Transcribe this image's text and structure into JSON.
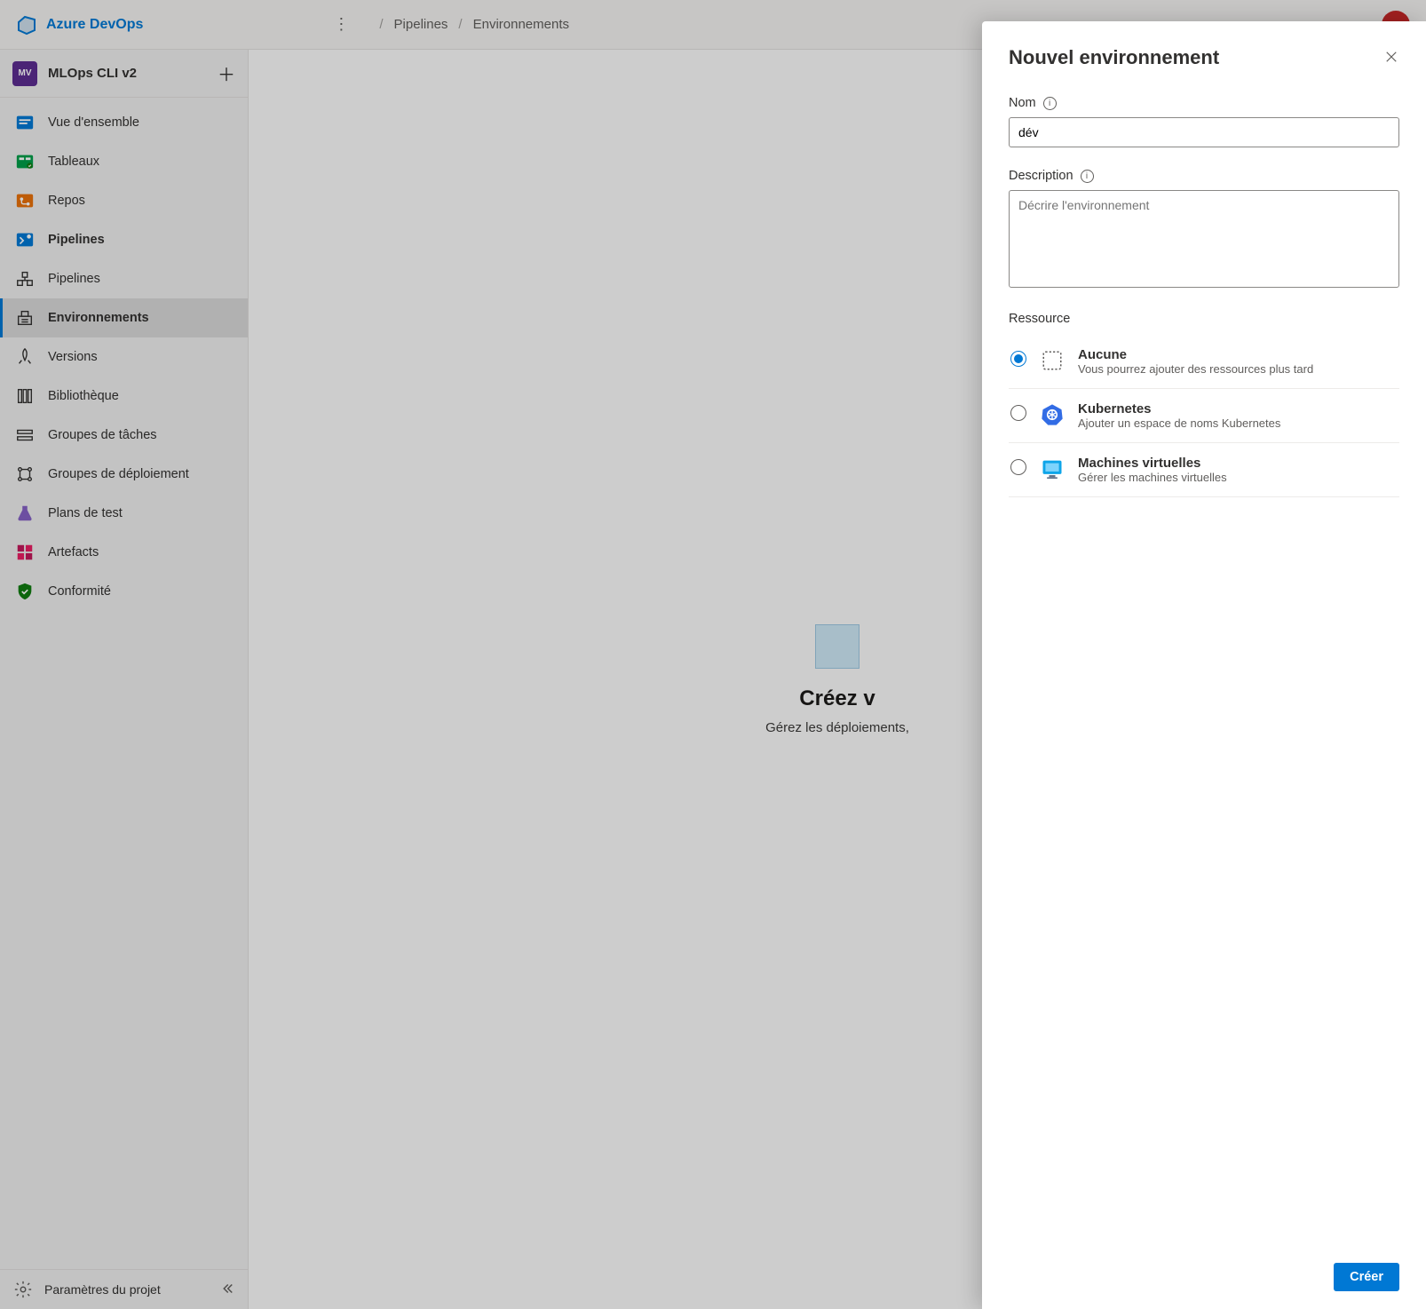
{
  "header": {
    "brand": "Azure DevOps",
    "breadcrumb": [
      "Pipelines",
      "Environnements"
    ]
  },
  "sidebar": {
    "project": {
      "badge": "MV",
      "name": "MLOps CLI v2"
    },
    "items": [
      {
        "label": "Vue d'ensemble",
        "icon": "overview-icon",
        "color": "#0078d4"
      },
      {
        "label": "Tableaux",
        "icon": "boards-icon",
        "color": "#009e49"
      },
      {
        "label": "Repos",
        "icon": "repos-icon",
        "color": "#e8710a"
      },
      {
        "label": "Pipelines",
        "icon": "pipelines-icon",
        "color": "#0078d4",
        "active_parent": true,
        "children": [
          {
            "label": "Pipelines",
            "icon": "pipelines-sub-icon"
          },
          {
            "label": "Environnements",
            "icon": "environments-icon",
            "selected": true
          },
          {
            "label": "Versions",
            "icon": "releases-icon"
          },
          {
            "label": "Bibliothèque",
            "icon": "library-icon"
          },
          {
            "label": "Groupes de tâches",
            "icon": "taskgroups-icon"
          },
          {
            "label": "Groupes de déploiement",
            "icon": "deploygroups-icon"
          }
        ]
      },
      {
        "label": "Plans de test",
        "icon": "test-icon",
        "color": "#8661c5"
      },
      {
        "label": "Artefacts",
        "icon": "artifacts-icon",
        "color": "#c2185b"
      },
      {
        "label": "Conformité",
        "icon": "compliance-icon",
        "color": "#107c10"
      }
    ],
    "footer": {
      "label": "Paramètres du projet"
    }
  },
  "main": {
    "title": "Créez v",
    "subtitle": "Gérez les déploiements,"
  },
  "panel": {
    "title": "Nouvel environnement",
    "name_label": "Nom",
    "name_value": "dév",
    "description_label": "Description",
    "description_placeholder": "Décrire l'environnement",
    "resource_label": "Ressource",
    "resources": [
      {
        "title": "Aucune",
        "subtitle": "Vous pourrez ajouter des ressources plus tard",
        "checked": true,
        "icon": "none-icon"
      },
      {
        "title": "Kubernetes",
        "subtitle": "Ajouter un espace de noms Kubernetes",
        "checked": false,
        "icon": "kubernetes-icon"
      },
      {
        "title": "Machines virtuelles",
        "subtitle": "Gérer les machines virtuelles",
        "checked": false,
        "icon": "vm-icon"
      }
    ],
    "create_button": "Créer"
  }
}
